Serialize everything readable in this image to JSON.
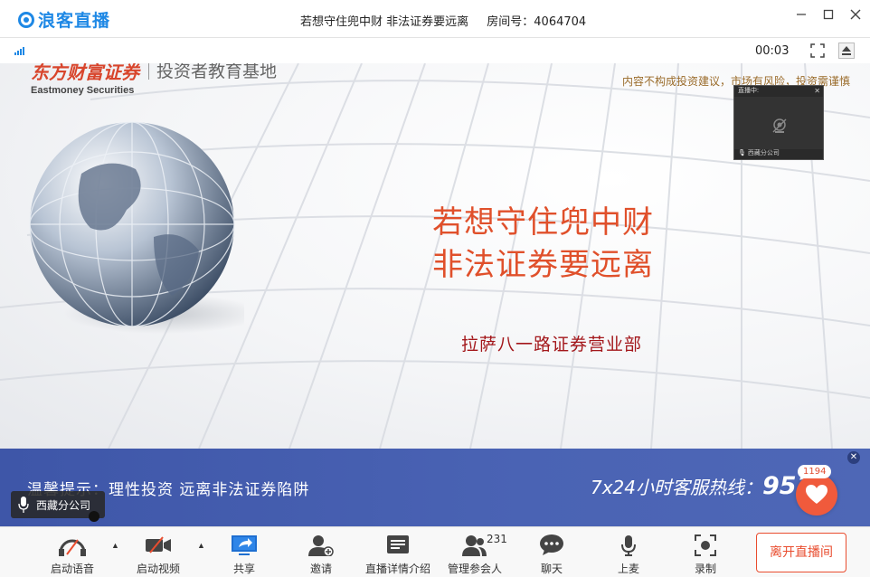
{
  "app": {
    "name": "浪客直播"
  },
  "titlebar": {
    "room_title": "若想守住兜中财 非法证券要远离",
    "room_id_label": "房间号：4064704"
  },
  "player": {
    "timer": "00:03"
  },
  "slide": {
    "brand_cn": "东方财富证券",
    "brand_en": "Eastmoney Securities",
    "brand_sub": "投资者教育基地",
    "disclaimer": "内容不构成投资建议，市场有风险，投资需谨慎",
    "title_line1": "若想守住兜中财",
    "title_line2": "非法证券要远离",
    "subtitle": "拉萨八一路证券营业部"
  },
  "preview": {
    "header": "直播中:",
    "name": "西藏分公司"
  },
  "banner": {
    "tip": "温馨提示：理性投资  远离非法证券陷阱",
    "hotline_label": "7x24小时客服热线：",
    "hotline_number": "953",
    "like_count": "1194"
  },
  "speaker": {
    "name": "西藏分公司"
  },
  "toolbar": {
    "audio": "启动语音",
    "video": "启动视频",
    "share": "共享",
    "invite": "邀请",
    "details": "直播详情介绍",
    "members": "管理参会人",
    "member_count": "231",
    "chat": "聊天",
    "mic": "上麦",
    "record": "录制",
    "leave": "离开直播间"
  },
  "colors": {
    "accent": "#1e88e5",
    "banner": "#4a63b4",
    "title_red": "#e0502b",
    "leave": "#e94d2f"
  }
}
